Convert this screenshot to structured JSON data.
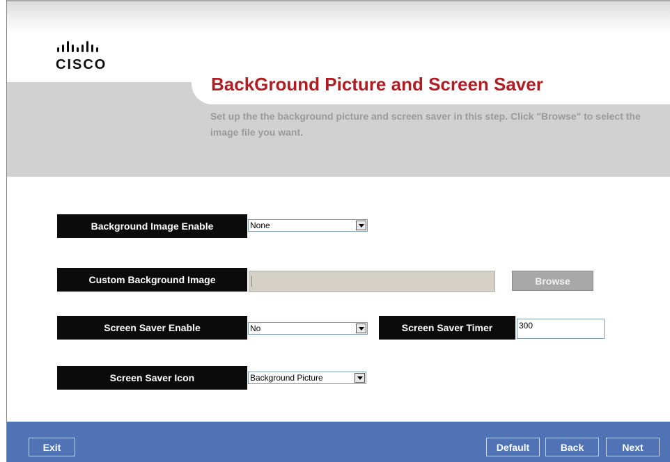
{
  "brand": {
    "wordmark": "CISCO"
  },
  "header": {
    "title": "BackGround Picture and Screen Saver",
    "subtitle": "Set up the the background picture and screen saver in this step. Click \"Browse\" to select the image file you want."
  },
  "form": {
    "background_image_enable": {
      "label": "Background Image Enable",
      "value": "None"
    },
    "custom_background_image": {
      "label": "Custom Background Image",
      "value": "",
      "browse_label": "Browse"
    },
    "screen_saver_enable": {
      "label": "Screen Saver Enable",
      "value": "No"
    },
    "screen_saver_timer": {
      "label": "Screen Saver Timer",
      "value": "300"
    },
    "screen_saver_icon": {
      "label": "Screen Saver Icon",
      "value": "Background Picture"
    }
  },
  "footer": {
    "exit_label": "Exit",
    "default_label": "Default",
    "back_label": "Back",
    "next_label": "Next"
  },
  "colors": {
    "title_red": "#b01e23",
    "footer_blue": "#4f73b5",
    "header_gray": "#d1d1d1"
  }
}
